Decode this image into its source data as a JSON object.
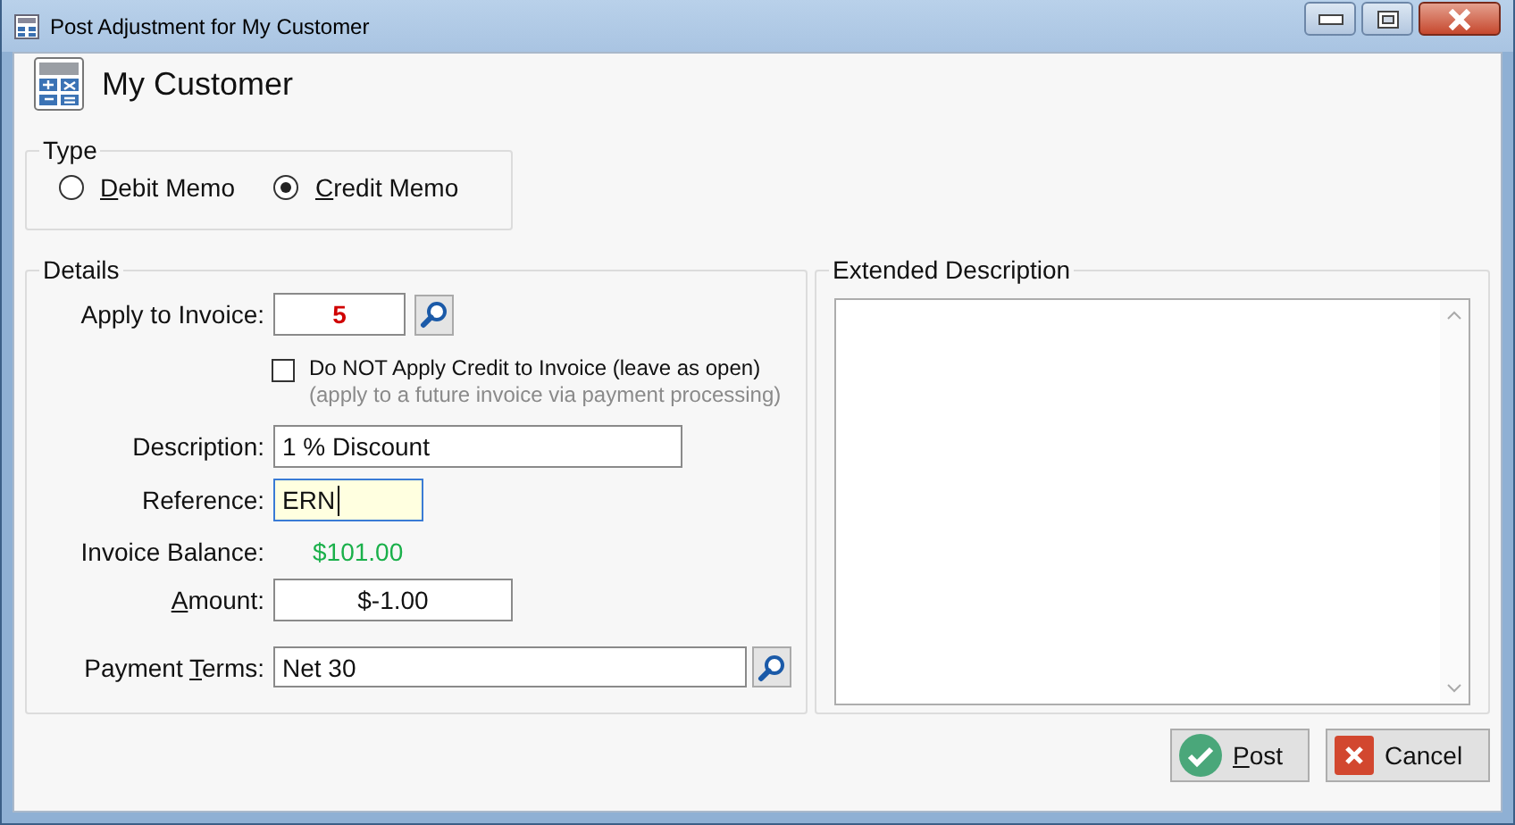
{
  "window": {
    "title": "Post Adjustment for My Customer"
  },
  "header": {
    "title": "My Customer"
  },
  "type_group": {
    "legend": "Type",
    "options": [
      {
        "label": [
          {
            "text": "D",
            "underline": true
          },
          {
            "text": "ebit Memo",
            "underline": false
          }
        ],
        "selected": false
      },
      {
        "label": [
          {
            "text": "C",
            "underline": true
          },
          {
            "text": "redit Memo",
            "underline": false
          }
        ],
        "selected": true
      }
    ]
  },
  "details": {
    "legend": "Details",
    "apply_to_invoice": {
      "label": "Apply to Invoice:",
      "value": "5"
    },
    "do_not_apply": {
      "label": "Do NOT Apply Credit to Invoice (leave as open)",
      "hint": "(apply to a future invoice via payment processing)",
      "checked": false
    },
    "description": {
      "label": "Description:",
      "value": "1 % Discount"
    },
    "reference": {
      "label": "Reference:",
      "value": "ERN",
      "focused": true
    },
    "invoice_balance": {
      "label": "Invoice Balance:",
      "value": "$101.00"
    },
    "amount": {
      "label": [
        {
          "text": "A",
          "underline": true
        },
        {
          "text": "mount:",
          "underline": false
        }
      ],
      "value": "$-1.00"
    },
    "payment_terms": {
      "label": [
        {
          "text": "Payment ",
          "underline": false
        },
        {
          "text": "T",
          "underline": true
        },
        {
          "text": "erms:",
          "underline": false
        }
      ],
      "value": "Net 30"
    }
  },
  "extended_description": {
    "legend": "Extended Description"
  },
  "buttons": [
    {
      "kind": "post",
      "label": [
        {
          "text": "P",
          "underline": true
        },
        {
          "text": "ost",
          "underline": false
        }
      ]
    },
    {
      "kind": "cancel",
      "label": [
        {
          "text": "Cancel",
          "underline": false
        }
      ]
    }
  ]
}
